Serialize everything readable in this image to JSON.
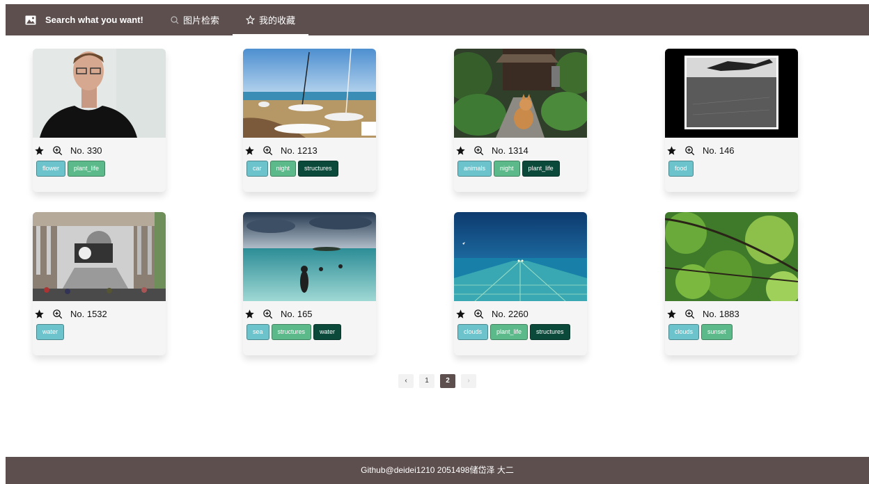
{
  "navbar": {
    "brand": "Search what you want!",
    "tabs": [
      {
        "label": "图片检索",
        "active": false
      },
      {
        "label": "我的收藏",
        "active": true
      }
    ]
  },
  "cards": [
    {
      "number": "No. 330",
      "tags": [
        {
          "label": "flower",
          "color": "#6cc3cc"
        },
        {
          "label": "plant_life",
          "color": "#5cba8a"
        }
      ]
    },
    {
      "number": "No. 1213",
      "tags": [
        {
          "label": "car",
          "color": "#6cc3cc"
        },
        {
          "label": "night",
          "color": "#5cba8a"
        },
        {
          "label": "structures",
          "color": "#0b4a3a"
        }
      ]
    },
    {
      "number": "No. 1314",
      "tags": [
        {
          "label": "animals",
          "color": "#6cc3cc"
        },
        {
          "label": "night",
          "color": "#5cba8a"
        },
        {
          "label": "plant_life",
          "color": "#0b4a3a"
        }
      ]
    },
    {
      "number": "No. 146",
      "tags": [
        {
          "label": "food",
          "color": "#6cc3cc"
        }
      ]
    },
    {
      "number": "No. 1532",
      "tags": [
        {
          "label": "water",
          "color": "#6cc3cc"
        }
      ]
    },
    {
      "number": "No. 165",
      "tags": [
        {
          "label": "sea",
          "color": "#6cc3cc"
        },
        {
          "label": "structures",
          "color": "#5cba8a"
        },
        {
          "label": "water",
          "color": "#0b4a3a"
        }
      ]
    },
    {
      "number": "No. 2260",
      "tags": [
        {
          "label": "clouds",
          "color": "#6cc3cc"
        },
        {
          "label": "plant_life",
          "color": "#5cba8a"
        },
        {
          "label": "structures",
          "color": "#0b4a3a"
        }
      ]
    },
    {
      "number": "No. 1883",
      "tags": [
        {
          "label": "clouds",
          "color": "#6cc3cc"
        },
        {
          "label": "sunset",
          "color": "#5cba8a"
        }
      ]
    }
  ],
  "pagination": {
    "prev": "‹",
    "pages": [
      "1",
      "2"
    ],
    "current": "2",
    "next": "›"
  },
  "footer": {
    "text": "Github@deidei1210 2051498储岱泽 大二"
  },
  "colors": {
    "nav": "#5e4f4f",
    "tag_primary": "#6cc3cc",
    "tag_success": "#5cba8a",
    "tag_dark": "#0b4a3a"
  }
}
